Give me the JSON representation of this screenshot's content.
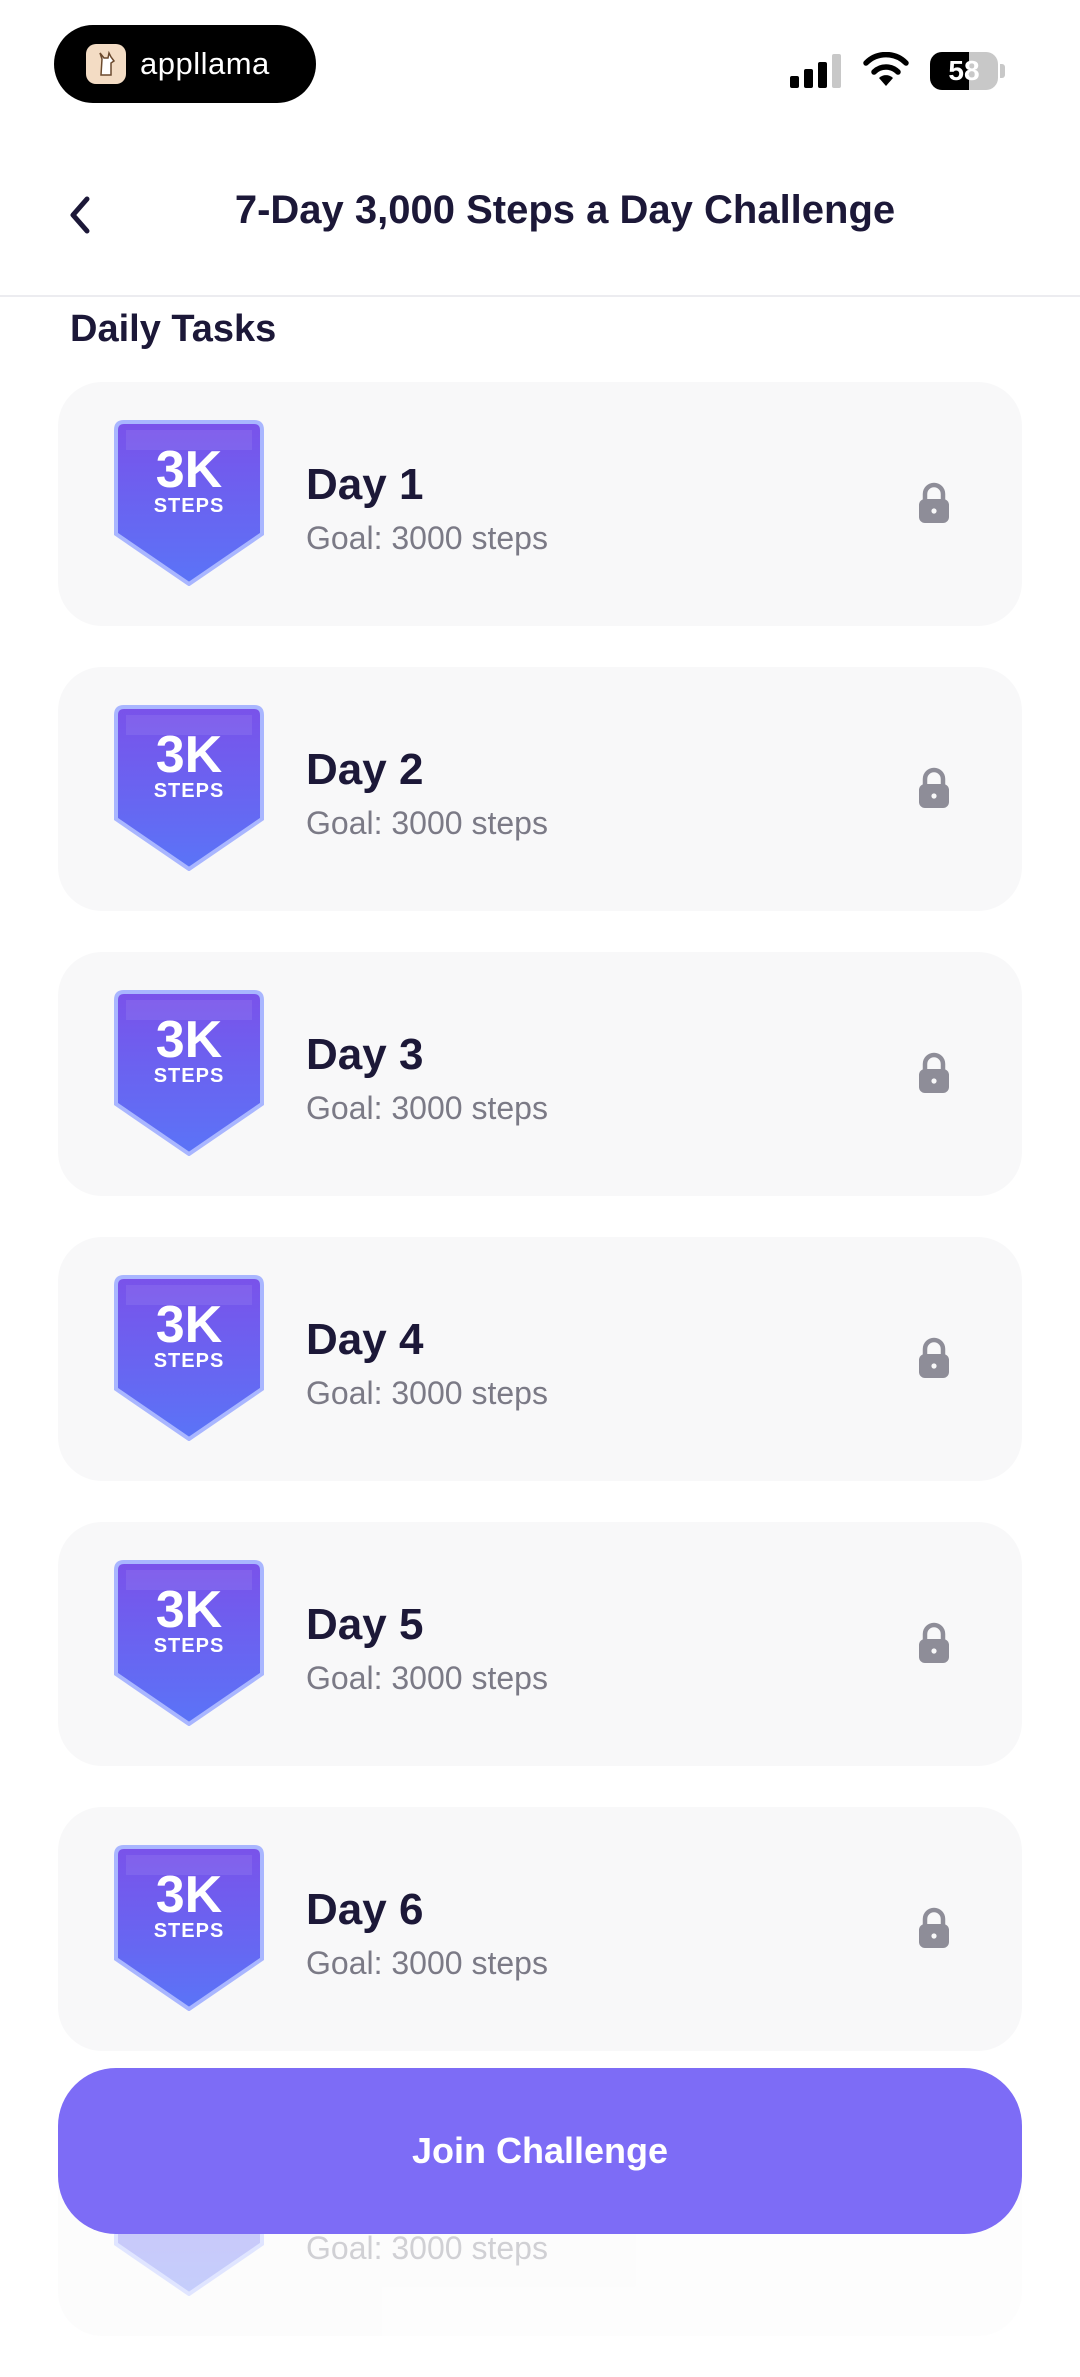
{
  "status_bar": {
    "brand_name": "appllama",
    "battery_level": "58",
    "battery_percent": 58
  },
  "header": {
    "title": "7-Day 3,000 Steps a Day Challenge"
  },
  "section": {
    "title": "Daily Tasks"
  },
  "badge": {
    "big": "3K",
    "small": "STEPS"
  },
  "tasks": [
    {
      "title": "Day 1",
      "goal": "Goal: 3000 steps"
    },
    {
      "title": "Day 2",
      "goal": "Goal: 3000 steps"
    },
    {
      "title": "Day 3",
      "goal": "Goal: 3000 steps"
    },
    {
      "title": "Day 4",
      "goal": "Goal: 3000 steps"
    },
    {
      "title": "Day 5",
      "goal": "Goal: 3000 steps"
    },
    {
      "title": "Day 6",
      "goal": "Goal: 3000 steps"
    },
    {
      "title": "",
      "goal": "Goal: 3000 steps"
    }
  ],
  "footer": {
    "join_label": "Join Challenge"
  },
  "colors": {
    "accent": "#7d6cf6",
    "badge_top": "#7a52ea",
    "badge_bottom": "#5a74f7",
    "title_text": "#1c1838",
    "muted_text": "#7b7a86",
    "lock": "#8e8d98",
    "card_bg": "#f8f8f9"
  }
}
